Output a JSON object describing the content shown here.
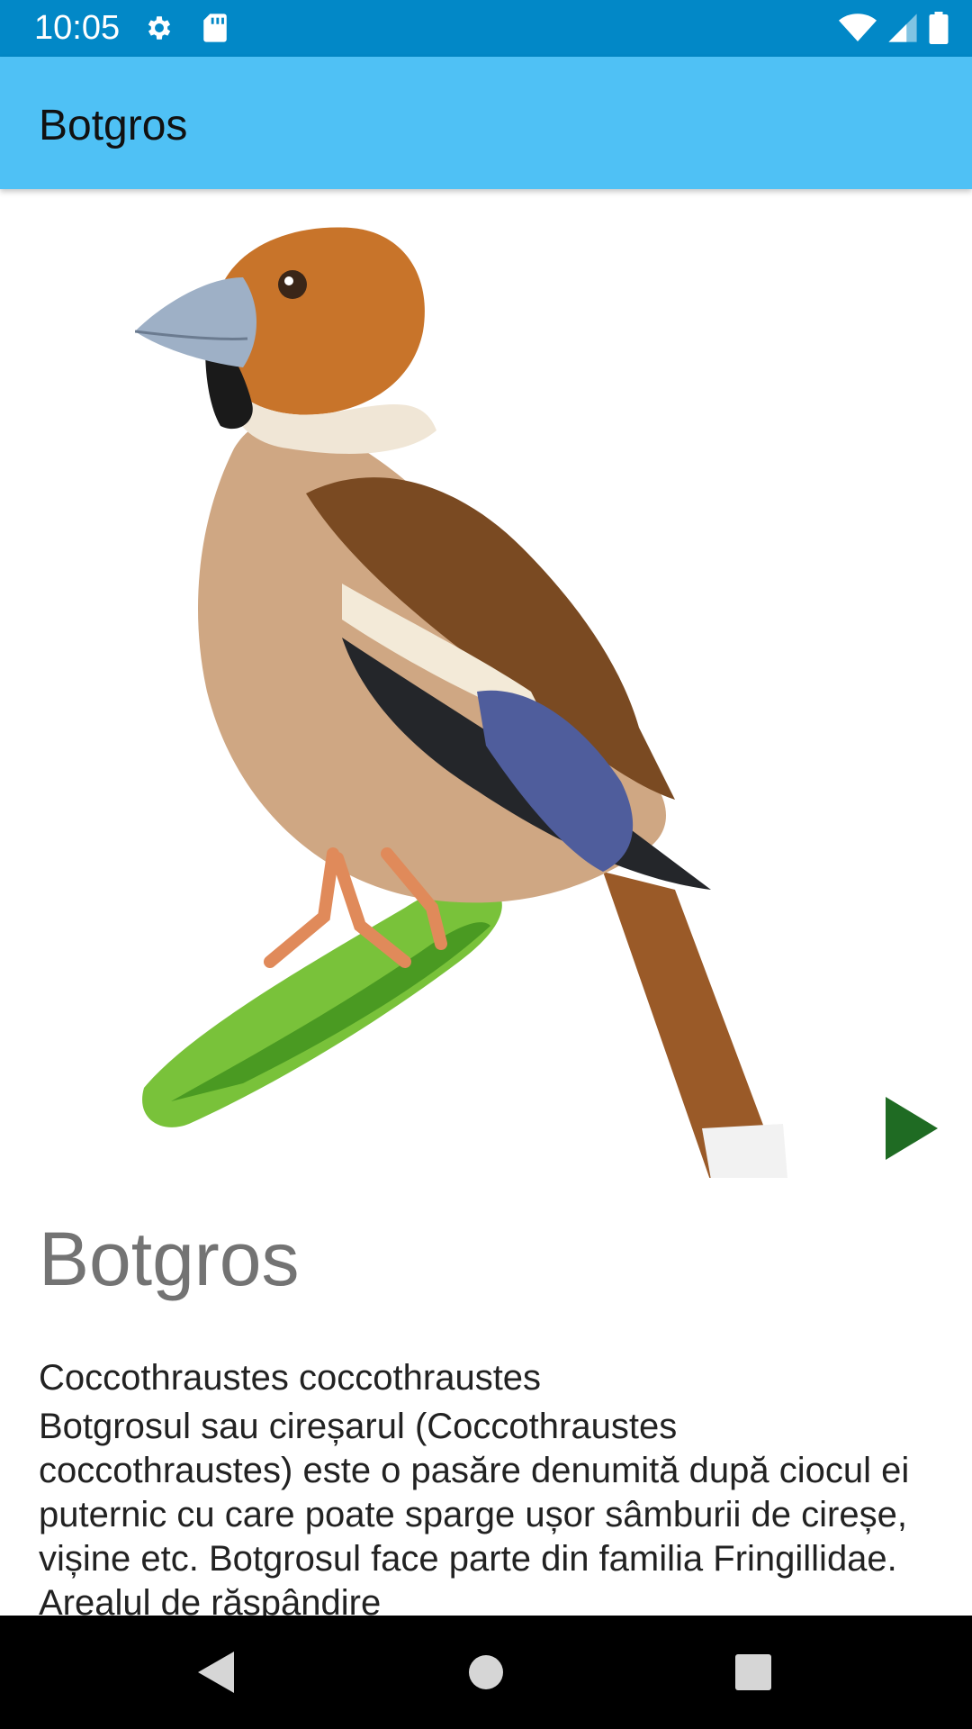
{
  "status_bar": {
    "time": "10:05",
    "icons": [
      "gear-icon",
      "sd-card-icon",
      "wifi-icon",
      "cell-signal-icon",
      "battery-icon"
    ]
  },
  "app_bar": {
    "title": "Botgros"
  },
  "bird": {
    "image": "hawfinch-illustration",
    "name": "Botgros",
    "latin_name": "Coccothraustes coccothraustes",
    "description": "Botgrosul sau cireșarul (Coccothraustes coccothraustes) este o pasăre denumită după ciocul ei puternic cu care poate sparge ușor sâmburii de cireșe, vișine etc. Botgrosul face parte din familia Fringillidae. Arealul de răspândire"
  },
  "colors": {
    "status_bar": "#0288c7",
    "app_bar": "#4fc1f5",
    "play_button": "#1f6b23",
    "title_gray": "#737373"
  },
  "nav_bar": {
    "icons": [
      "back-icon",
      "home-icon",
      "recents-icon"
    ]
  }
}
